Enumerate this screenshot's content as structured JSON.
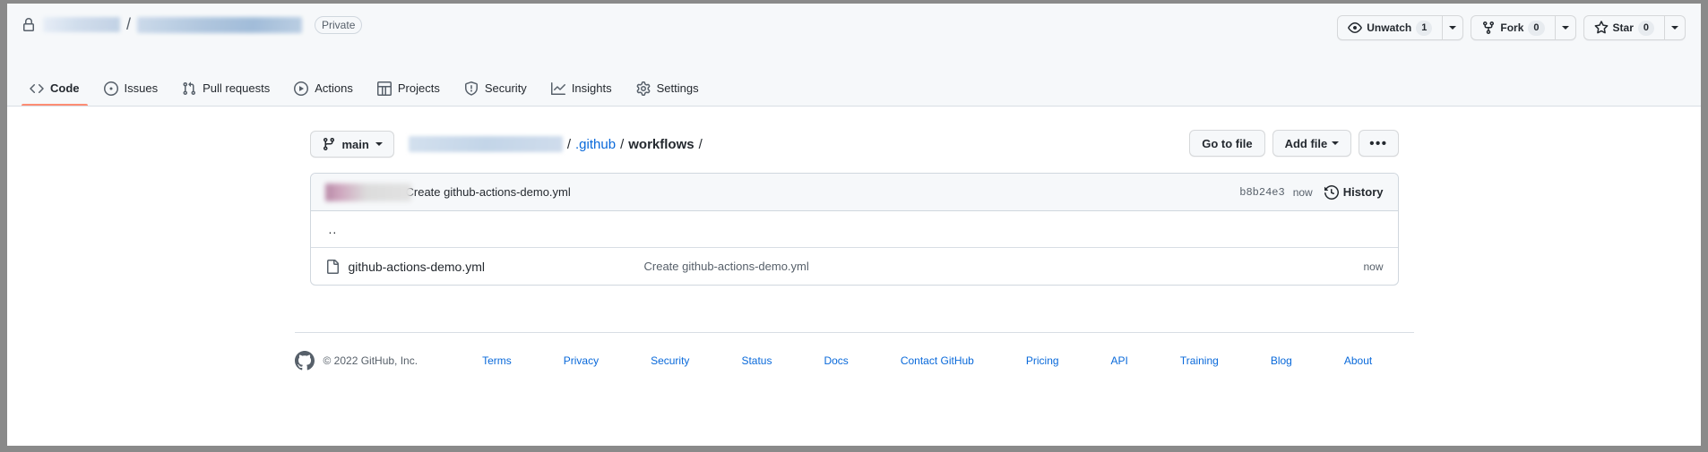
{
  "repo_header": {
    "lock_icon": "lock-icon",
    "owner_redacted": true,
    "separator": "/",
    "name_redacted": true,
    "visibility_badge": "Private",
    "actions": [
      {
        "icon": "eye-icon",
        "label": "Unwatch",
        "count": "1",
        "has_caret": true
      },
      {
        "icon": "fork-icon",
        "label": "Fork",
        "count": "0",
        "has_caret": true
      },
      {
        "icon": "star-icon",
        "label": "Star",
        "count": "0",
        "has_caret": true
      }
    ]
  },
  "nav": {
    "tabs": [
      {
        "label": "Code",
        "icon": "code-icon",
        "active": true
      },
      {
        "label": "Issues",
        "icon": "issue-opened-icon",
        "active": false
      },
      {
        "label": "Pull requests",
        "icon": "git-pull-request-icon",
        "active": false
      },
      {
        "label": "Actions",
        "icon": "play-icon",
        "active": false
      },
      {
        "label": "Projects",
        "icon": "table-icon",
        "active": false
      },
      {
        "label": "Security",
        "icon": "shield-icon",
        "active": false
      },
      {
        "label": "Insights",
        "icon": "graph-icon",
        "active": false
      },
      {
        "label": "Settings",
        "icon": "gear-icon",
        "active": false
      }
    ],
    "active_underline_color": "#fd8c73"
  },
  "path_bar": {
    "branch": {
      "icon": "git-branch-icon",
      "name": "main",
      "has_caret": true
    },
    "breadcrumb": {
      "repo_redacted": true,
      "sep1": "/",
      "segment_github": ".github",
      "sep2": "/",
      "segment_workflows": "workflows",
      "sep3": "/"
    },
    "buttons": {
      "go_to_file": "Go to file",
      "add_file": "Add file",
      "kebab": "•••"
    }
  },
  "file_table": {
    "commit_header": {
      "author_redacted": true,
      "message": "Create github-actions-demo.yml",
      "sha": "b8b24e3",
      "time": "now",
      "history_label": "History",
      "history_icon": "history-icon"
    },
    "columns": [
      "name",
      "message",
      "time"
    ],
    "rows": [
      {
        "kind": "parent",
        "name": "..",
        "message": "",
        "time": ""
      },
      {
        "kind": "file",
        "icon": "file-icon",
        "name": "github-actions-demo.yml",
        "message": "Create github-actions-demo.yml",
        "time": "now"
      }
    ]
  },
  "footer": {
    "logo": "github-mark-icon",
    "copyright": "© 2022 GitHub, Inc.",
    "links": [
      "Terms",
      "Privacy",
      "Security",
      "Status",
      "Docs",
      "Contact GitHub",
      "Pricing",
      "API",
      "Training",
      "Blog",
      "About"
    ]
  },
  "colors": {
    "link": "#0969da",
    "accent_underline": "#fd8c73",
    "header_bg": "#f6f8fa",
    "border": "#d0d7de",
    "text": "#24292f",
    "muted": "#57606a"
  }
}
